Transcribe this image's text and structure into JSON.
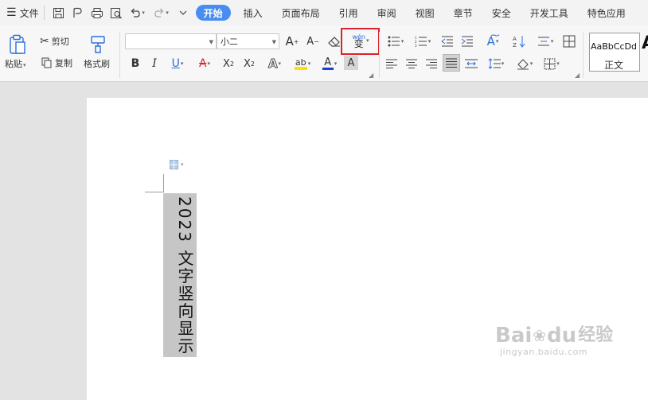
{
  "menu": {
    "file_label": "文件",
    "tabs": [
      {
        "label": "开始",
        "active": true
      },
      {
        "label": "插入"
      },
      {
        "label": "页面布局"
      },
      {
        "label": "引用"
      },
      {
        "label": "审阅"
      },
      {
        "label": "视图"
      },
      {
        "label": "章节"
      },
      {
        "label": "安全"
      },
      {
        "label": "开发工具"
      },
      {
        "label": "特色应用"
      }
    ]
  },
  "ribbon": {
    "paste_label": "粘贴",
    "cut_label": "剪切",
    "copy_label": "复制",
    "format_painter_label": "格式刷",
    "font_name_value": "",
    "font_size_value": "小二",
    "pinyin_glyph_top": "wén",
    "pinyin_glyph_bottom": "变",
    "style_sample": "AaBbCcDd",
    "style_name": "正文",
    "style_next_glyph": "A"
  },
  "document": {
    "vertical_text": "2023 文字竖向显示"
  },
  "watermark": {
    "brand": "Bai",
    "brand2": "du",
    "brand_suffix": "经验",
    "url": "jingyan.baidu.com"
  },
  "colors": {
    "accent": "#4a8df0",
    "highlight_border": "#d9232d",
    "selection_bg": "#c6c6c6",
    "font_color_bar": "#ff0000",
    "highlight_bar": "#ffe000",
    "font_color_a_bar": "#1a40d8"
  }
}
